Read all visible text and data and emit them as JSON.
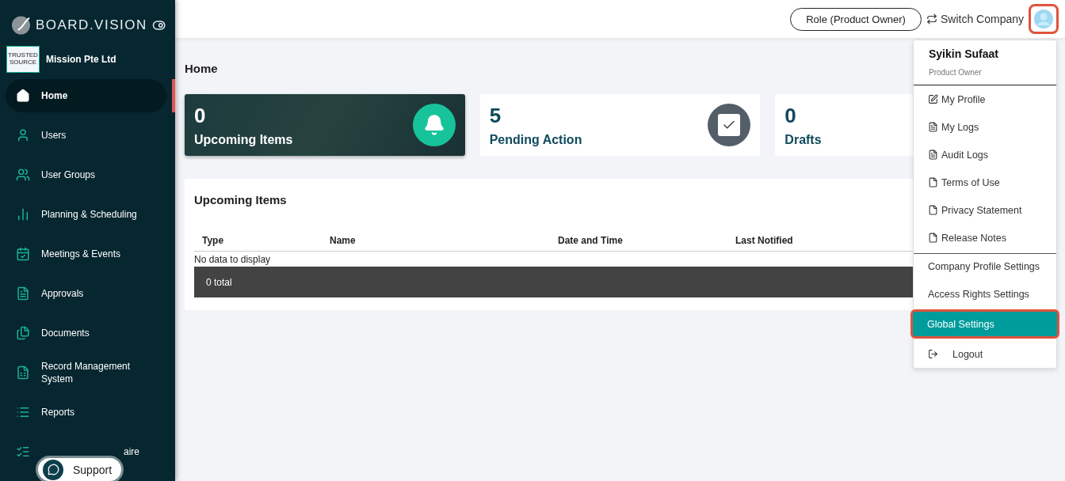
{
  "brand": {
    "name": "BOARD.VISION"
  },
  "company": {
    "logo_text": "TRUSTED SOURCE",
    "name": "Mission Pte Ltd"
  },
  "sidebar": {
    "items": [
      {
        "label": "Home",
        "selected": true
      },
      {
        "label": "Users",
        "selected": false
      },
      {
        "label": "User Groups",
        "selected": false
      },
      {
        "label": "Planning & Scheduling",
        "selected": false
      },
      {
        "label": "Meetings & Events",
        "selected": false
      },
      {
        "label": "Approvals",
        "selected": false
      },
      {
        "label": "Documents",
        "selected": false
      },
      {
        "label": "Record Management System",
        "selected": false
      },
      {
        "label": "Reports",
        "selected": false
      },
      {
        "label": "aire",
        "selected": false
      }
    ]
  },
  "support": {
    "label": "Support"
  },
  "topbar": {
    "role_button": "Role (Product Owner)",
    "switch_company": "Switch Company",
    "avatar_highlighted": true
  },
  "page": {
    "title": "Home"
  },
  "stats": [
    {
      "value": "0",
      "label": "Upcoming Items",
      "kind": "alert"
    },
    {
      "value": "5",
      "label": "Pending Action",
      "kind": "pending"
    },
    {
      "value": "0",
      "label": "Drafts",
      "kind": "draft"
    }
  ],
  "table": {
    "title": "Upcoming Items",
    "columns": [
      "Type",
      "Name",
      "Date and Time",
      "Last Notified"
    ],
    "empty": "No data to display",
    "footer": "0 total"
  },
  "user_menu": {
    "name": "Syikin Sufaat",
    "role": "Product Owner",
    "items": [
      {
        "label": "My Profile",
        "kind": "edit",
        "selected": false,
        "highlighted": false
      },
      {
        "label": "My Logs",
        "kind": "log",
        "selected": false,
        "highlighted": false
      },
      {
        "label": "Audit Logs",
        "kind": "log",
        "selected": false,
        "highlighted": false
      },
      {
        "label": "Terms of Use",
        "kind": "file",
        "selected": false,
        "highlighted": false
      },
      {
        "label": "Privacy Statement",
        "kind": "file",
        "selected": false,
        "highlighted": false
      },
      {
        "label": "Release Notes",
        "kind": "file",
        "selected": false,
        "highlighted": false
      },
      {
        "label": "Company Profile Settings",
        "kind": "plain",
        "selected": false,
        "highlighted": false
      },
      {
        "label": "Access Rights Settings",
        "kind": "plain",
        "selected": false,
        "highlighted": false
      },
      {
        "label": "Global Settings",
        "kind": "plain",
        "selected": true,
        "highlighted": true
      },
      {
        "label": "Logout",
        "kind": "logout",
        "selected": false,
        "highlighted": false
      }
    ]
  }
}
